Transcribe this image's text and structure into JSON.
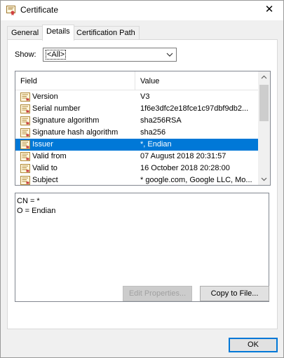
{
  "window": {
    "title": "Certificate",
    "close_glyph": "✕"
  },
  "tabs": [
    {
      "label": "General"
    },
    {
      "label": "Details"
    },
    {
      "label": "Certification Path"
    }
  ],
  "show": {
    "label": "Show:",
    "selected": "<All>"
  },
  "list": {
    "columns": {
      "field": "Field",
      "value": "Value"
    },
    "rows": [
      {
        "field": "Version",
        "value": "V3"
      },
      {
        "field": "Serial number",
        "value": "1f6e3dfc2e18fce1c97dbf9db2..."
      },
      {
        "field": "Signature algorithm",
        "value": "sha256RSA"
      },
      {
        "field": "Signature hash algorithm",
        "value": "sha256"
      },
      {
        "field": "Issuer",
        "value": "*, Endian"
      },
      {
        "field": "Valid from",
        "value": "07 August 2018 20:31:57"
      },
      {
        "field": "Valid to",
        "value": "16 October 2018 20:28:00"
      },
      {
        "field": "Subject",
        "value": "* google.com, Google LLC, Mo..."
      }
    ],
    "selected_index": 4
  },
  "details": {
    "lines": [
      "CN = *",
      "O = Endian"
    ]
  },
  "buttons": {
    "edit_properties": "Edit Properties...",
    "copy_to_file": "Copy to File...",
    "ok": "OK"
  },
  "colors": {
    "selection": "#0078d7",
    "accent": "#0078d7"
  },
  "icons": {
    "title": "certificate-icon",
    "close": "close-icon",
    "dropdown": "chevron-down-icon",
    "field": "certificate-field-icon"
  }
}
